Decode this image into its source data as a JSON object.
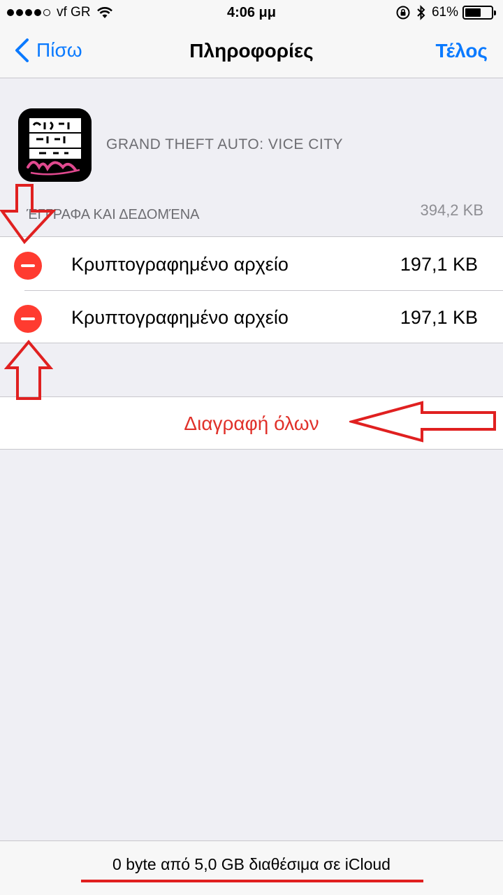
{
  "status_bar": {
    "carrier": "vf GR",
    "time": "4:06 μμ",
    "battery_percent": "61%",
    "battery_level": 0.61,
    "icons": [
      "signal-dots-icon",
      "wifi-icon",
      "orientation-lock-icon",
      "bluetooth-icon",
      "battery-icon"
    ]
  },
  "nav": {
    "back_label": "Πίσω",
    "title": "Πληροφορίες",
    "done_label": "Τέλος"
  },
  "app": {
    "name": "GRAND THEFT AUTO: VICE CITY",
    "icon_logo_text": "grand theft auto vice city"
  },
  "section": {
    "title": "ΈΓΓΡΑΦΑ ΚΑΙ ΔΕΔΟΜΈΝΑ",
    "size": "394,2 KB"
  },
  "files": [
    {
      "label": "Κρυπτογραφημένο αρχείο",
      "size": "197,1 KB"
    },
    {
      "label": "Κρυπτογραφημένο αρχείο",
      "size": "197,1 KB"
    }
  ],
  "delete_all_label": "Διαγραφή όλων",
  "footer": {
    "text": "0 byte από 5,0 GB διαθέσιμα σε iCloud"
  },
  "colors": {
    "ios_blue": "#0a7aff",
    "destructive_red": "#ff3b30",
    "annotation_red": "#e02020",
    "background": "#efeff4"
  }
}
